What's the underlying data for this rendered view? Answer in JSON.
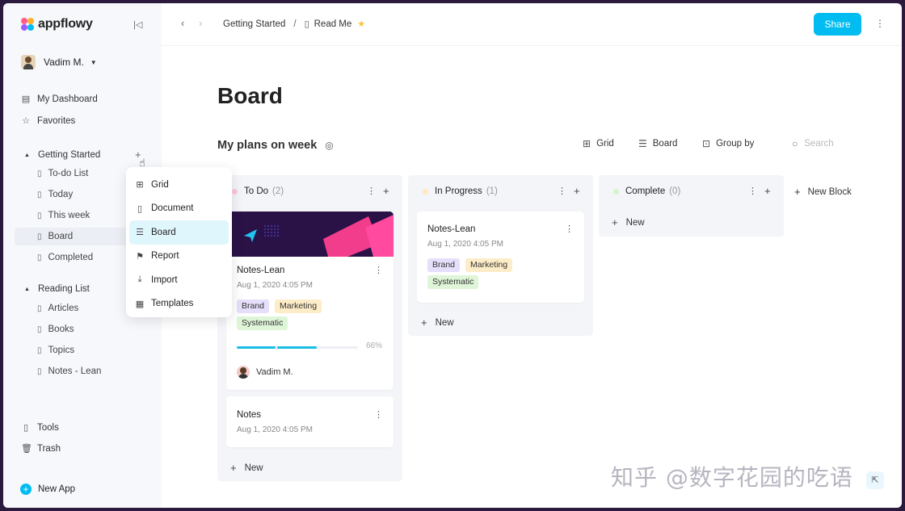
{
  "app": {
    "name": "appflowy"
  },
  "sidebar": {
    "user": "Vadim M.",
    "top_items": [
      {
        "label": "My Dashboard",
        "icon": "dashboard-icon"
      },
      {
        "label": "Favorites",
        "icon": "star-icon"
      }
    ],
    "sections": [
      {
        "label": "Getting Started",
        "pages": [
          "To-do List",
          "Today",
          "This week",
          "Board",
          "Completed"
        ],
        "active_page": "Board"
      },
      {
        "label": "Reading List",
        "pages": [
          "Articles",
          "Books",
          "Topics",
          "Notes - Lean"
        ]
      }
    ],
    "bottom_items": [
      {
        "label": "Tools",
        "icon": "document-icon"
      },
      {
        "label": "Trash",
        "icon": "trash-icon"
      }
    ],
    "new_app": "New App"
  },
  "menu": {
    "items": [
      {
        "label": "Grid",
        "icon": "grid-icon"
      },
      {
        "label": "Document",
        "icon": "document-icon"
      },
      {
        "label": "Board",
        "icon": "board-icon"
      },
      {
        "label": "Report",
        "icon": "flag-icon"
      },
      {
        "label": "Import",
        "icon": "import-icon"
      },
      {
        "label": "Templates",
        "icon": "template-icon"
      }
    ],
    "active": "Board"
  },
  "topbar": {
    "breadcrumb": [
      "Getting Started",
      "Read Me"
    ],
    "share_label": "Share"
  },
  "main": {
    "title": "Board",
    "view_title": "My plans on week",
    "toolbar": {
      "grid": "Grid",
      "board": "Board",
      "group_by": "Group by"
    },
    "search_placeholder": "Search",
    "new_block": "New Block",
    "columns": [
      {
        "name": "To Do",
        "count": "(2)",
        "dot_color": "#fbc9d6",
        "cards": [
          {
            "title": "Notes-Lean",
            "date": "Aug 1, 2020 4:05 PM",
            "tags": [
              "Brand",
              "Marketing",
              "Systematic"
            ],
            "progress": 0.66,
            "progress_label": "66%",
            "assignee": "Vadim M."
          },
          {
            "title": "Notes",
            "date": "Aug 1, 2020 4:05 PM"
          }
        ],
        "new_label": "New"
      },
      {
        "name": "In Progress",
        "count": "(1)",
        "dot_color": "#fde9bd",
        "cards": [
          {
            "title": "Notes-Lean",
            "date": "Aug 1, 2020 4:05 PM",
            "tags": [
              "Brand",
              "Marketing",
              "Systematic"
            ]
          }
        ],
        "new_label": "New"
      },
      {
        "name": "Complete",
        "count": "(0)",
        "dot_color": "#d4f5c8",
        "cards": [],
        "new_label": "New"
      }
    ]
  },
  "watermark": "知乎 @数字花园的吃语",
  "colors": {
    "accent": "#00bcf0",
    "sidebar_bg": "#f7f8fc",
    "column_bg": "#f4f5f9"
  }
}
